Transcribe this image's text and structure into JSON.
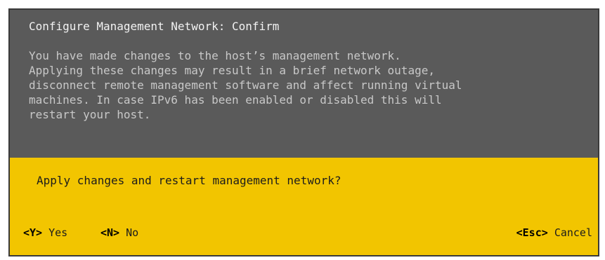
{
  "dialog": {
    "title": "Configure Management Network: Confirm",
    "message_lines": [
      "You have made changes to the host’s management network.",
      "Applying these changes may result in a brief network outage,",
      "disconnect remote management software and affect running virtual",
      "machines. In case IPv6 has been enabled or disabled this will",
      "restart your host."
    ],
    "prompt": "Apply changes and restart management network?"
  },
  "actions": {
    "yes": {
      "key": "<Y>",
      "label": "Yes"
    },
    "no": {
      "key": "<N>",
      "label": "No"
    },
    "cancel": {
      "key": "<Esc>",
      "label": "Cancel"
    }
  },
  "colors": {
    "top_panel": "#5a5a5a",
    "bottom_panel": "#f2c500",
    "title_text": "#f2f2f2",
    "message_text": "#c8c8c8",
    "prompt_text": "#1c1c1c"
  }
}
